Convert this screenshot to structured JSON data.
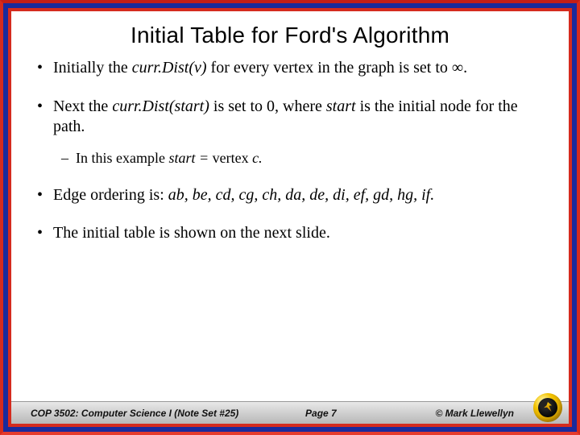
{
  "title": "Initial Table for Ford's Algorithm",
  "bullets": {
    "b1_pre": "Initially the ",
    "b1_em": "curr.Dist(v)",
    "b1_post": " for every vertex in the graph is set to ∞.",
    "b2_pre": "Next the ",
    "b2_em1": "curr.Dist(start)",
    "b2_mid": " is set to 0, where ",
    "b2_em2": "start ",
    "b2_post": "is the initial node for the path.",
    "b2s_pre": "In this example ",
    "b2s_em": "start = ",
    "b2s_post": "vertex ",
    "b2s_em2": "c.",
    "b3_pre": "Edge ordering is: ",
    "b3_em": "ab, be, cd, cg, ch, da, de, di, ef, gd, hg, if.",
    "b4": "The initial table is shown on the next slide."
  },
  "footer": {
    "course": "COP 3502: Computer Science I (Note Set #25)",
    "page": "Page 7",
    "author": "© Mark Llewellyn"
  }
}
